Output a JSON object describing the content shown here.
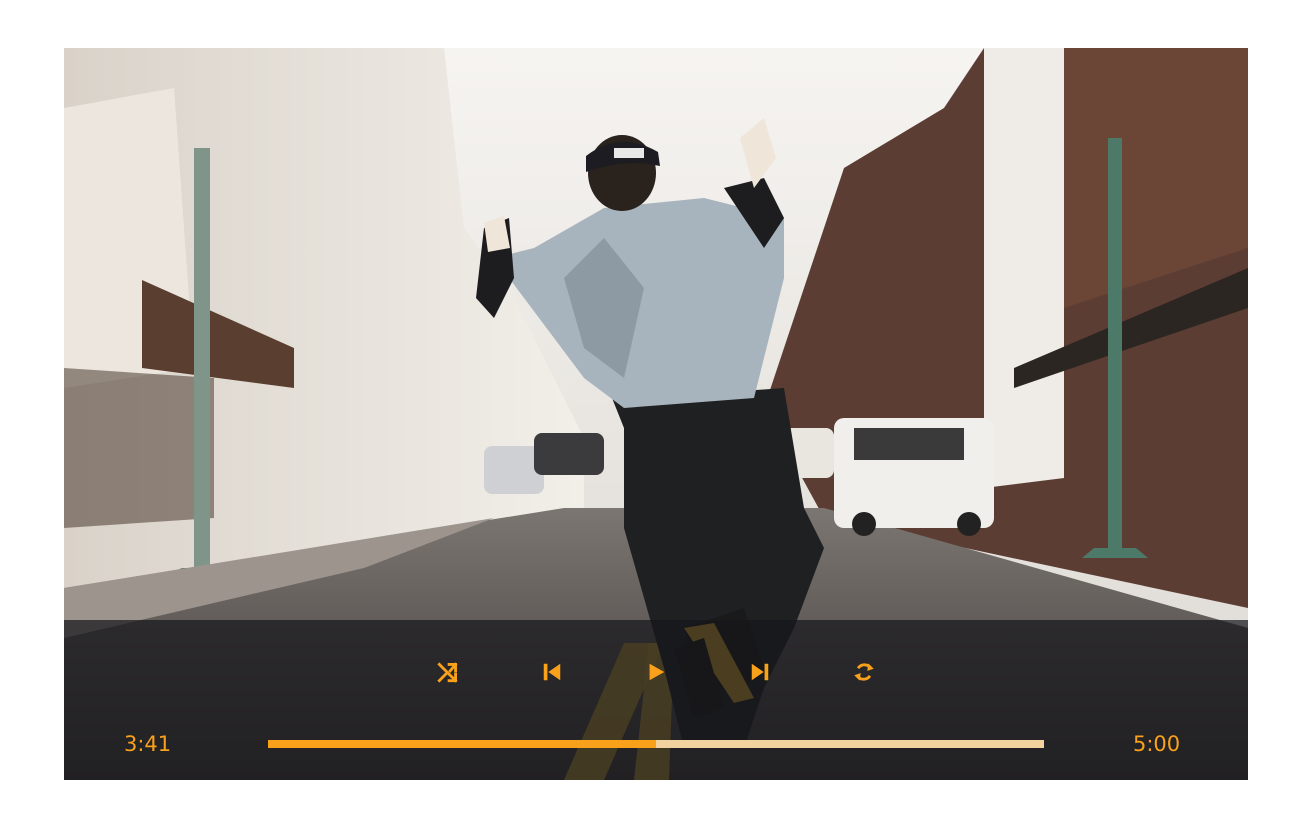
{
  "player": {
    "accent_color": "#F9A11B",
    "track_color": "#F2D3A0",
    "current_time": "3:41",
    "total_time": "5:00",
    "progress": 0.5
  },
  "controls": {
    "shuffle_icon": "shuffle-icon",
    "previous_icon": "skip-previous-icon",
    "play_icon": "play-icon",
    "next_icon": "skip-next-icon",
    "repeat_icon": "repeat-icon"
  }
}
